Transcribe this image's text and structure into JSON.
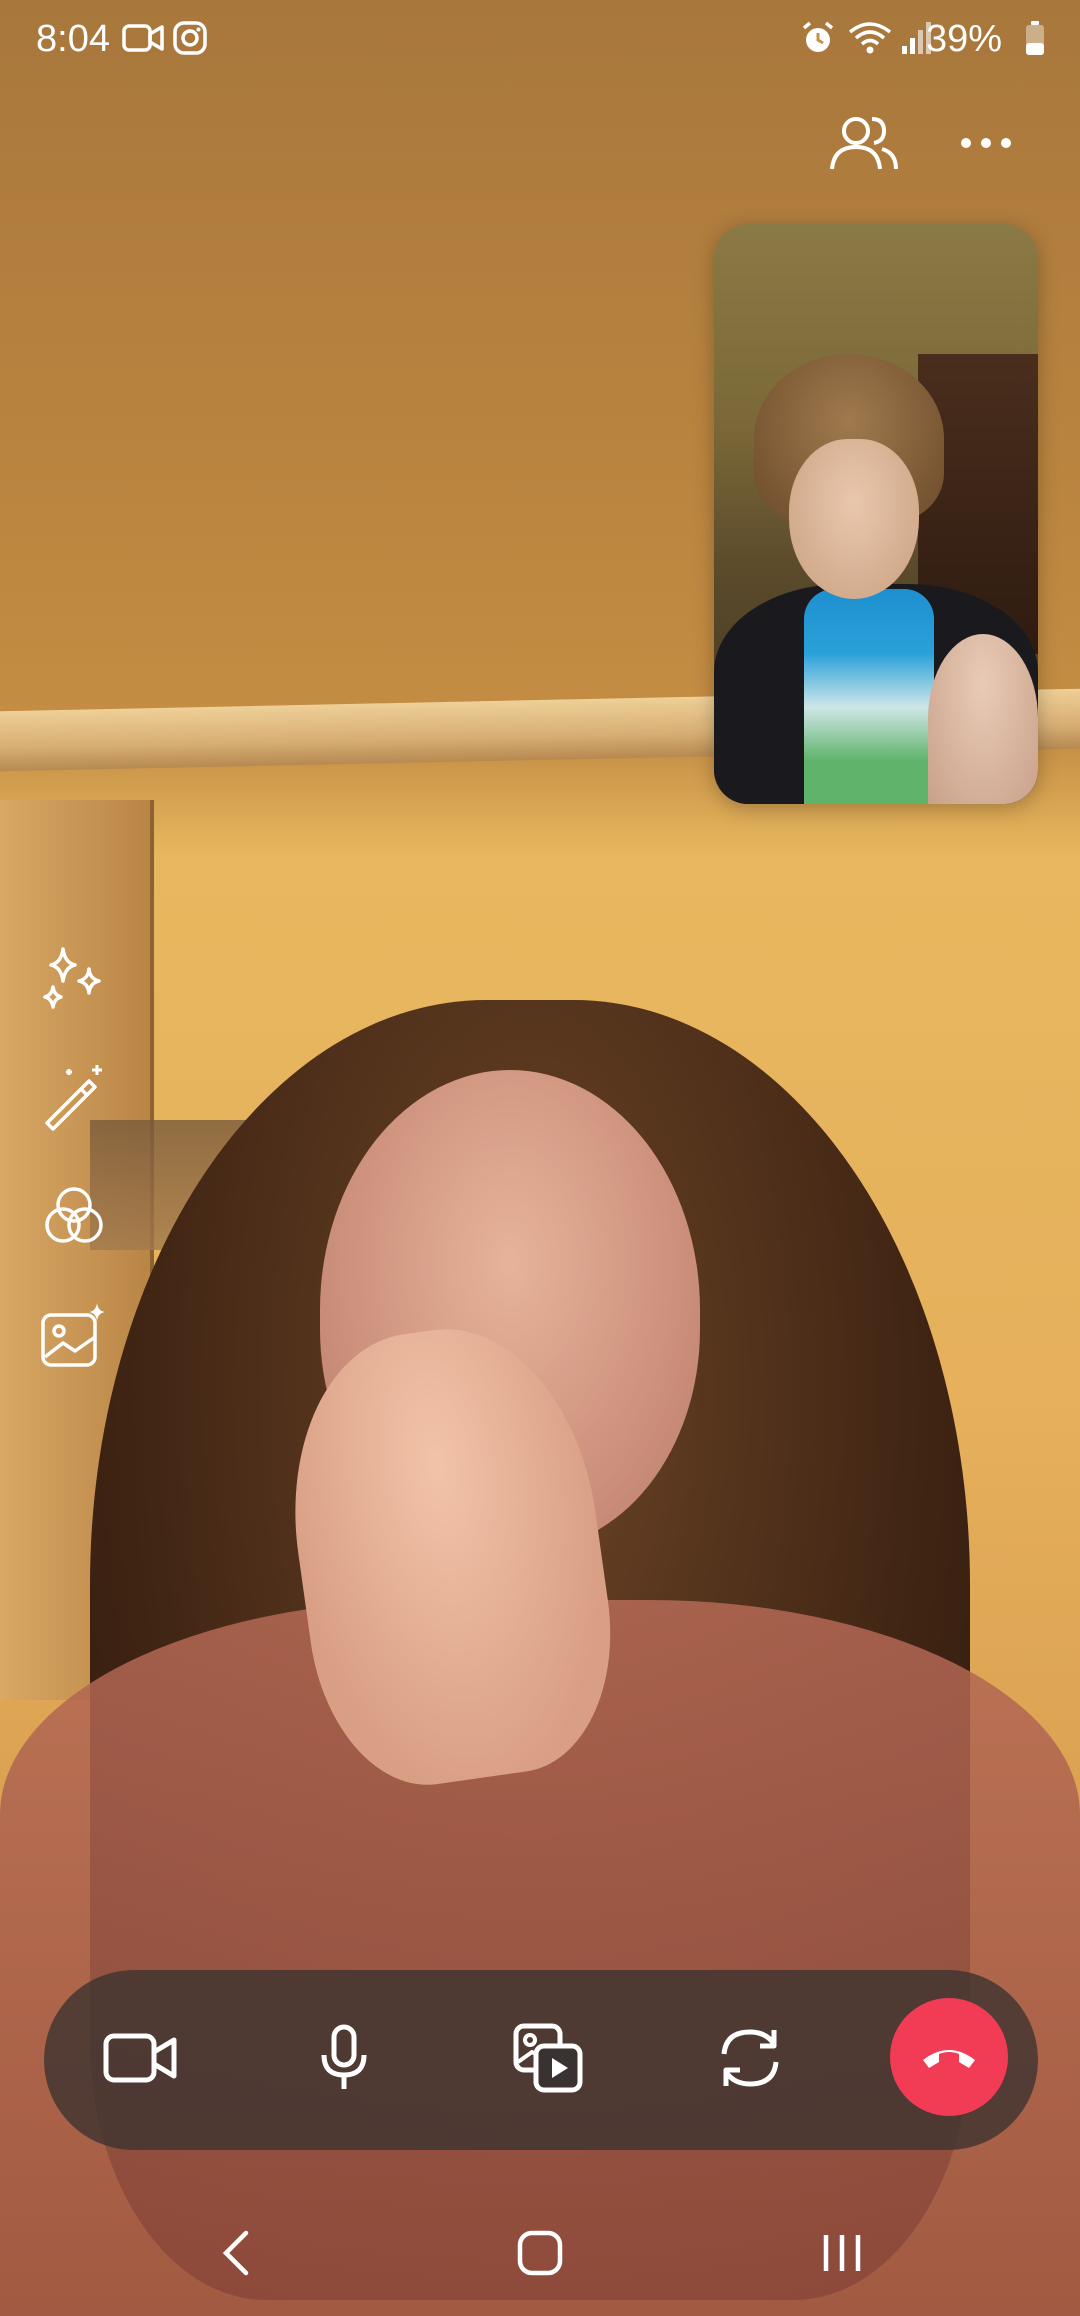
{
  "status_bar": {
    "time": "8:04",
    "battery_percent": "39%",
    "left_icons": [
      "video-camera-icon",
      "instagram-icon"
    ],
    "right_icons": [
      "alarm-icon",
      "wifi-icon",
      "signal-icon",
      "battery-icon"
    ]
  },
  "top_actions": {
    "icons": [
      "participants-icon",
      "more-options-icon"
    ]
  },
  "effects_rail": {
    "icons": [
      "sparkles-icon",
      "magic-wand-icon",
      "filters-icon",
      "backgrounds-icon"
    ]
  },
  "call_controls": {
    "icons": [
      "video-camera-icon",
      "microphone-icon",
      "share-media-icon",
      "flip-camera-icon",
      "end-call-icon"
    ],
    "end_call_color": "#f23b55",
    "bar_color": "#3a3230"
  },
  "nav_bar": {
    "icons": [
      "back-icon",
      "home-icon",
      "recents-icon"
    ]
  }
}
